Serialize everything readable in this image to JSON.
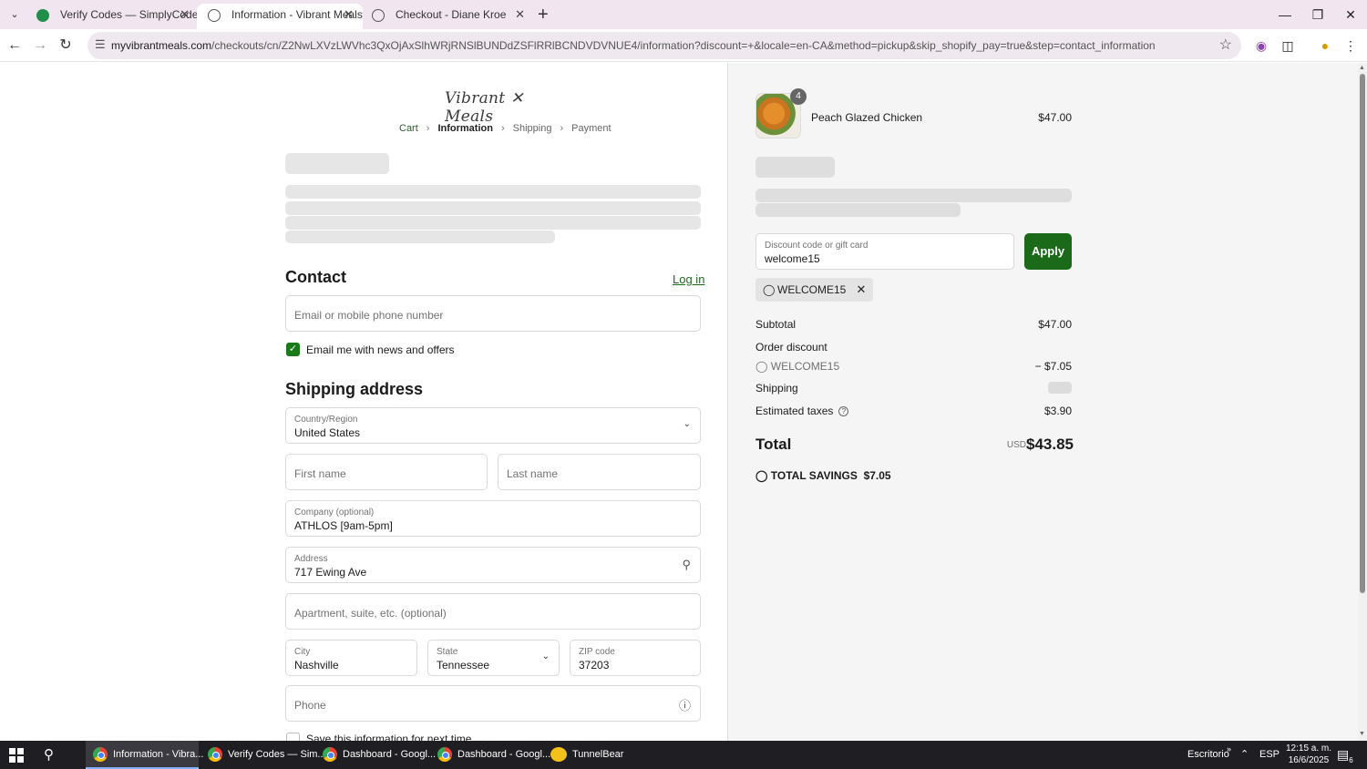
{
  "browser": {
    "tabs": [
      {
        "title": "Verify Codes — SimplyCodes",
        "active": false
      },
      {
        "title": "Information - Vibrant Meals - C",
        "active": true
      },
      {
        "title": "Checkout - Diane Kroe",
        "active": false
      }
    ],
    "url_domain": "myvibrantmeals.com",
    "url_path": "/checkouts/cn/Z2NwLXVzLWVhc3QxOjAxSlhWRjRNSlBUNDdZSFlRRlBCNDVDVNUE4/information?discount=+&locale=en-CA&method=pickup&skip_shopify_pay=true&step=contact_information"
  },
  "store": {
    "logo_text": "Vibrant ✕ Meals",
    "breadcrumbs": [
      "Cart",
      "Information",
      "Shipping",
      "Payment"
    ]
  },
  "contact": {
    "heading": "Contact",
    "login_label": "Log in",
    "email_placeholder": "Email or mobile phone number",
    "newsletter_label": "Email me with news and offers",
    "newsletter_checked": true
  },
  "shipping": {
    "heading": "Shipping address",
    "country_label": "Country/Region",
    "country_value": "United States",
    "first_name_placeholder": "First name",
    "last_name_placeholder": "Last name",
    "company_label": "Company (optional)",
    "company_value": "ATHLOS [9am-5pm]",
    "address_label": "Address",
    "address_value": "717 Ewing Ave",
    "apartment_placeholder": "Apartment, suite, etc. (optional)",
    "city_label": "City",
    "city_value": "Nashville",
    "state_label": "State",
    "state_value": "Tennessee",
    "zip_label": "ZIP code",
    "zip_value": "37203",
    "phone_placeholder": "Phone",
    "save_info_label": "Save this information for next time"
  },
  "summary": {
    "item": {
      "name": "Peach Glazed Chicken",
      "price": "$47.00",
      "quantity": "4"
    },
    "discount_label": "Discount code or gift card",
    "discount_value": "welcome15",
    "apply_label": "Apply",
    "applied_code": "WELCOME15",
    "subtotal_label": "Subtotal",
    "subtotal_value": "$47.00",
    "order_discount_label": "Order discount",
    "discount_code": "WELCOME15",
    "discount_amount": "− $7.05",
    "shipping_label": "Shipping",
    "taxes_label": "Estimated taxes",
    "taxes_value": "$3.90",
    "total_label": "Total",
    "total_currency": "USD",
    "total_value": "$43.85",
    "savings_label": "TOTAL SAVINGS",
    "savings_value": "$7.05"
  },
  "taskbar": {
    "items": [
      "Information - Vibra...",
      "Verify Codes — Sim...",
      "Dashboard - Googl...",
      "Dashboard - Googl...",
      "TunnelBear"
    ],
    "desktop_label": "Escritorio",
    "lang": "ESP",
    "time": "12:15 a. m.",
    "date": "16/6/2025",
    "notif_count": "6"
  },
  "colors": {
    "accent": "#1a6a1a",
    "skeleton": "#e6e6e6"
  }
}
